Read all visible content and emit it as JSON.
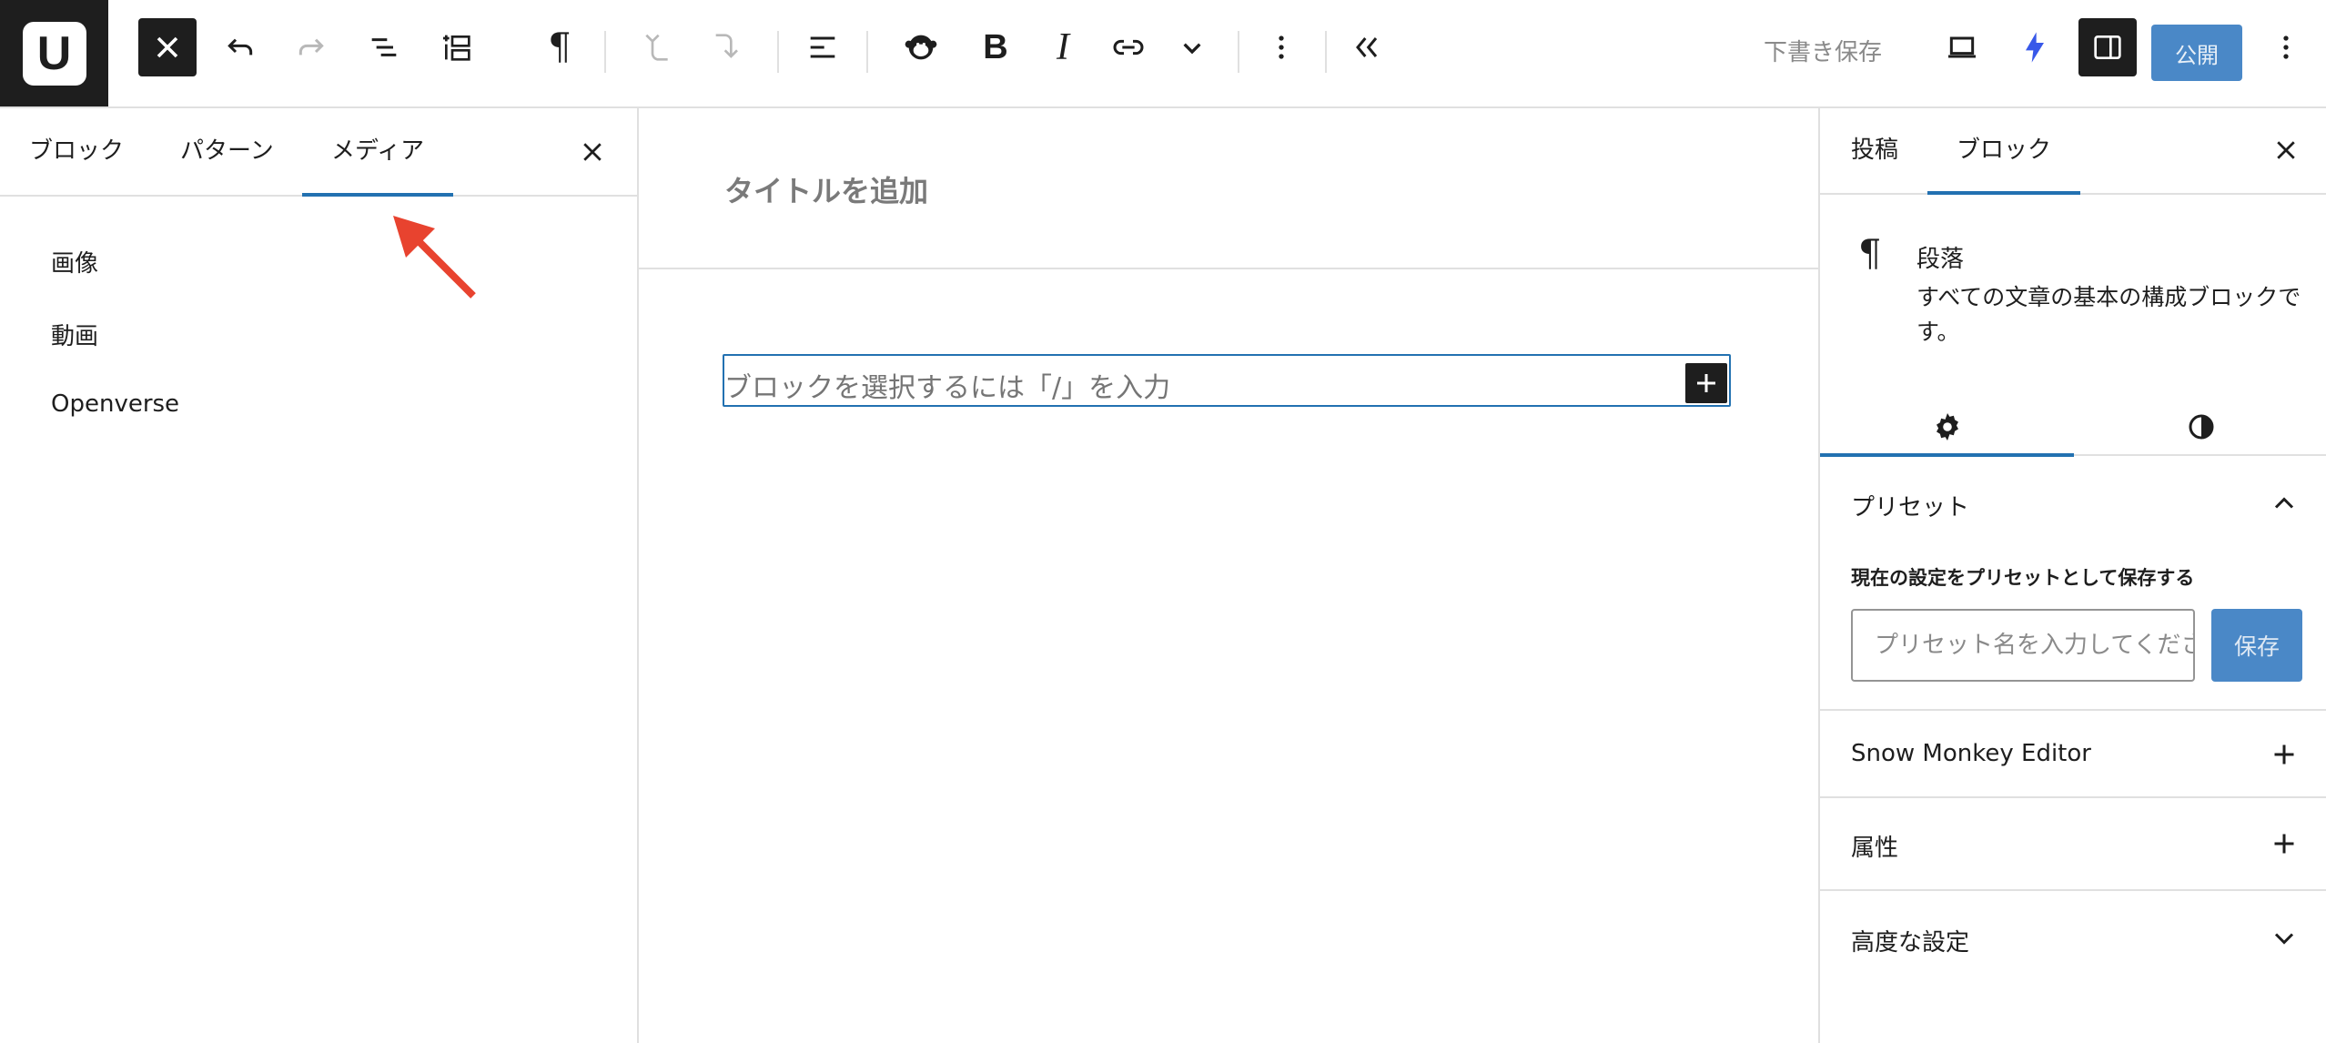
{
  "toolbar": {
    "logo_letter": "U",
    "save_draft_label": "下書き保存",
    "publish_label": "公開"
  },
  "inserter": {
    "tabs": [
      "ブロック",
      "パターン",
      "メディア"
    ],
    "active_tab": "メディア",
    "media_items": [
      "画像",
      "動画",
      "Openverse"
    ]
  },
  "editor": {
    "title_placeholder": "タイトルを追加",
    "paragraph_placeholder": "ブロックを選択するには「/」を入力"
  },
  "settings": {
    "tabs": [
      "投稿",
      "ブロック"
    ],
    "active_tab": "ブロック",
    "block_title": "段落",
    "block_description": "すべての文章の基本の構成ブロックです。",
    "preset_header": "プリセット",
    "preset_save_label": "現在の設定をプリセットとして保存する",
    "preset_input_placeholder": "プリセット名を入力してください",
    "preset_save_button": "保存",
    "panels": [
      "Snow Monkey Editor",
      "属性",
      "高度な設定"
    ]
  },
  "colors": {
    "accent": "#2271b1",
    "dark": "#1e1e1e",
    "annotation_arrow": "#e8432f"
  }
}
